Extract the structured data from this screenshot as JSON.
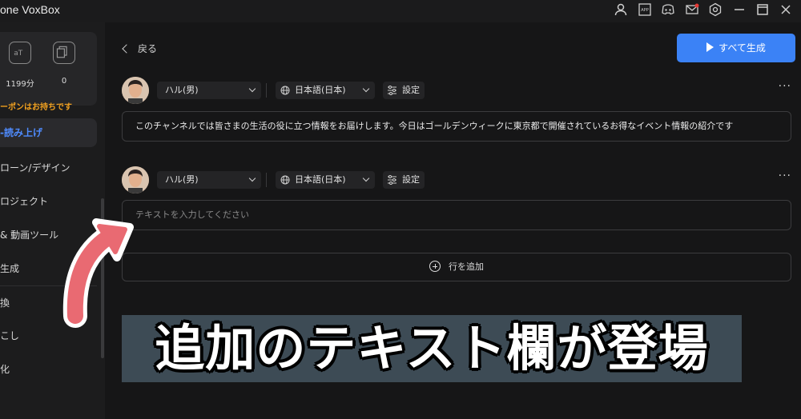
{
  "app": {
    "title": "one VoxBox"
  },
  "titlebar": {
    "icons": [
      "user-icon",
      "app-icon",
      "discord-icon",
      "mail-icon",
      "settings-icon",
      "minimize-icon",
      "maximize-icon",
      "close-icon"
    ]
  },
  "sidebar": {
    "stats": [
      {
        "icon": "text-icon",
        "value": "1199分"
      },
      {
        "icon": "clone-icon",
        "value": "0"
      }
    ],
    "coupon_text": "ーポンはお持ちです",
    "items": [
      {
        "label": "読み上げ",
        "active": true
      },
      {
        "label": "ローン/デザイン"
      },
      {
        "label": "ロジェクト"
      },
      {
        "label": "& 動画ツール"
      },
      {
        "label": "生成"
      },
      {
        "label": "換"
      },
      {
        "label": "こし"
      },
      {
        "label": "化"
      }
    ]
  },
  "main": {
    "back_label": "戻る",
    "generate_all_label": "すべて生成",
    "rows": [
      {
        "voice": "ハル(男)",
        "language": "日本語(日本)",
        "settings_label": "設定",
        "more": "···",
        "text": "このチャンネルでは皆さまの生活の役に立つ情報をお届けします。今日はゴールデンウィークに東京都で開催されているお得なイベント情報の紹介です",
        "placeholder": ""
      },
      {
        "voice": "ハル(男)",
        "language": "日本語(日本)",
        "settings_label": "設定",
        "more": "···",
        "text": "",
        "placeholder": "テキストを入力してください"
      }
    ],
    "add_row_label": "行を追加"
  },
  "overlay": {
    "caption": "追加のテキスト欄が登場",
    "caption_bg": "#3d4b55",
    "arrow_color": "#e96a72"
  },
  "colors": {
    "accent": "#3b82f6",
    "coupon": "#f0a020",
    "active_nav": "#4f8cff"
  }
}
